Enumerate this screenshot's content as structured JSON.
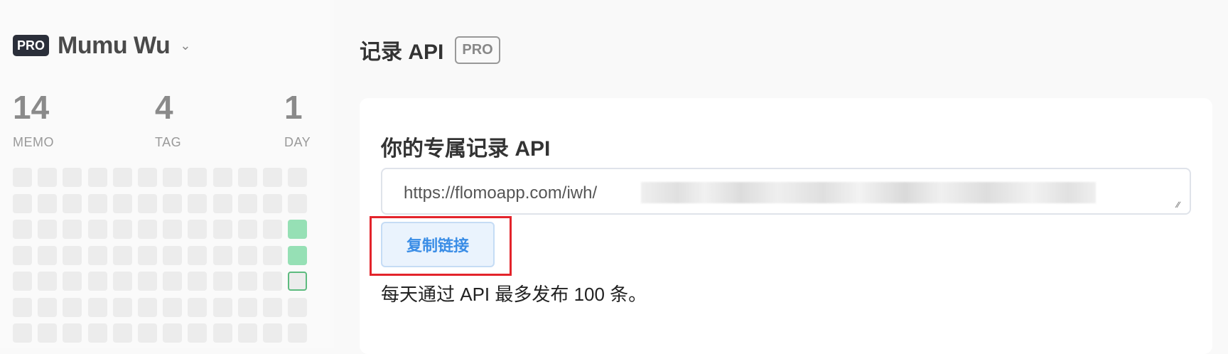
{
  "user": {
    "badge": "PRO",
    "name": "Mumu Wu"
  },
  "stats": [
    {
      "value": "14",
      "label": "MEMO"
    },
    {
      "value": "4",
      "label": "TAG"
    },
    {
      "value": "1",
      "label": "DAY"
    }
  ],
  "heatmap": {
    "rows": 7,
    "cols": 12,
    "active_cells": [
      {
        "row": 2,
        "col": 11,
        "state": "green"
      },
      {
        "row": 3,
        "col": 11,
        "state": "green"
      },
      {
        "row": 4,
        "col": 11,
        "state": "today"
      }
    ],
    "colors": {
      "empty": "#ececec",
      "active": "#96e0b5",
      "today_border": "#5dbb7f"
    }
  },
  "page": {
    "title": "记录 API",
    "badge": "PRO"
  },
  "card": {
    "title": "你的专属记录 API",
    "api_url_prefix": "https://flomoapp.com/iwh/",
    "copy_button_label": "复制链接",
    "note": "每天通过 API 最多发布 100 条。"
  },
  "colors": {
    "accent": "#3a8de6",
    "highlight": "#e3242b",
    "badge_bg": "#2b2f3a"
  }
}
